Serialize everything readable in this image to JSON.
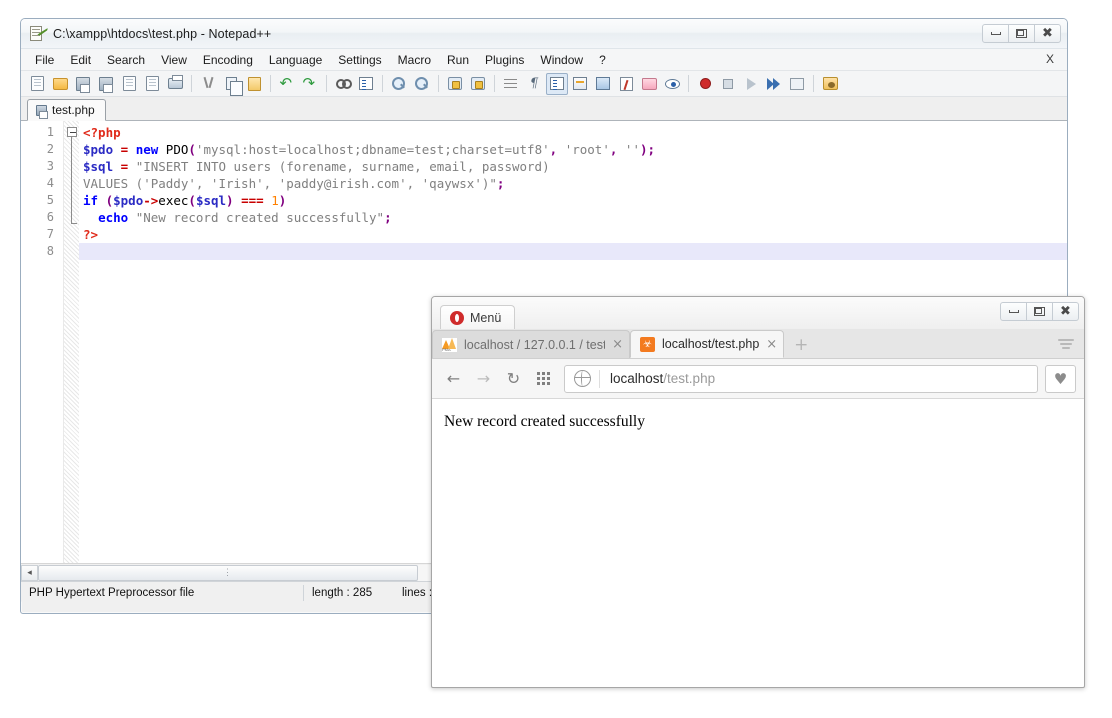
{
  "notepad": {
    "title": "C:\\xampp\\htdocs\\test.php - Notepad++",
    "icon": "notepad-plus-plus-icon",
    "window_buttons": {
      "minimize": "minimize-icon",
      "maximize": "maximize-icon",
      "close": "close-icon"
    },
    "menu": [
      "File",
      "Edit",
      "Search",
      "View",
      "Encoding",
      "Language",
      "Settings",
      "Macro",
      "Run",
      "Plugins",
      "Window",
      "?"
    ],
    "menu_close_doc": "X",
    "tab": {
      "label": "test.php"
    },
    "line_numbers": [
      "1",
      "2",
      "3",
      "4",
      "5",
      "6",
      "7",
      "8"
    ],
    "code_lines": [
      {
        "n": 1,
        "tokens": [
          {
            "t": "<?php",
            "c": "t-tag"
          }
        ]
      },
      {
        "n": 2,
        "tokens": [
          {
            "t": "$pdo",
            "c": "t-var"
          },
          {
            "t": " ",
            "c": "t-plain"
          },
          {
            "t": "=",
            "c": "t-op"
          },
          {
            "t": " ",
            "c": "t-plain"
          },
          {
            "t": "new",
            "c": "t-kw"
          },
          {
            "t": " PDO",
            "c": "t-plain"
          },
          {
            "t": "(",
            "c": "t-punc"
          },
          {
            "t": "'mysql:host=localhost;dbname=test;charset=utf8'",
            "c": "t-str"
          },
          {
            "t": ",",
            "c": "t-punc"
          },
          {
            "t": " ",
            "c": "t-plain"
          },
          {
            "t": "'root'",
            "c": "t-str"
          },
          {
            "t": ",",
            "c": "t-punc"
          },
          {
            "t": " ",
            "c": "t-plain"
          },
          {
            "t": "''",
            "c": "t-str"
          },
          {
            "t": ");",
            "c": "t-punc"
          }
        ]
      },
      {
        "n": 3,
        "tokens": [
          {
            "t": "$sql",
            "c": "t-var"
          },
          {
            "t": " ",
            "c": "t-plain"
          },
          {
            "t": "=",
            "c": "t-op"
          },
          {
            "t": " ",
            "c": "t-plain"
          },
          {
            "t": "\"INSERT INTO users (forename, surname, email, password)",
            "c": "t-str"
          }
        ]
      },
      {
        "n": 4,
        "tokens": [
          {
            "t": "VALUES ('Paddy', 'Irish', 'paddy@irish.com', 'qaywsx')\"",
            "c": "t-str"
          },
          {
            "t": ";",
            "c": "t-punc"
          }
        ]
      },
      {
        "n": 5,
        "tokens": [
          {
            "t": "if",
            "c": "t-kw"
          },
          {
            "t": " ",
            "c": "t-plain"
          },
          {
            "t": "(",
            "c": "t-punc"
          },
          {
            "t": "$pdo",
            "c": "t-var"
          },
          {
            "t": "->",
            "c": "t-op"
          },
          {
            "t": "exec",
            "c": "t-plain"
          },
          {
            "t": "(",
            "c": "t-punc"
          },
          {
            "t": "$sql",
            "c": "t-var"
          },
          {
            "t": ")",
            "c": "t-punc"
          },
          {
            "t": " ",
            "c": "t-plain"
          },
          {
            "t": "===",
            "c": "t-op"
          },
          {
            "t": " ",
            "c": "t-plain"
          },
          {
            "t": "1",
            "c": "t-num"
          },
          {
            "t": ")",
            "c": "t-punc"
          }
        ]
      },
      {
        "n": 6,
        "tokens": [
          {
            "t": "  ",
            "c": "t-plain"
          },
          {
            "t": "echo",
            "c": "t-kw"
          },
          {
            "t": " ",
            "c": "t-plain"
          },
          {
            "t": "\"New record created successfully\"",
            "c": "t-str"
          },
          {
            "t": ";",
            "c": "t-punc"
          }
        ]
      },
      {
        "n": 7,
        "tokens": [
          {
            "t": "?>",
            "c": "t-tag"
          }
        ]
      },
      {
        "n": 8,
        "tokens": [
          {
            "t": "",
            "c": "t-plain"
          }
        ]
      }
    ],
    "status": {
      "file_type": "PHP Hypertext Preprocessor file",
      "length": "length : 285",
      "lines": "lines :"
    },
    "hscroll": {
      "left_arrow": "◂",
      "thumb_grip": "⋮"
    }
  },
  "opera": {
    "menu_button": "Menü",
    "window_buttons": {
      "minimize": "minimize-icon",
      "maximize": "maximize-icon",
      "close": "close-icon"
    },
    "tabs": [
      {
        "label": "localhost / 127.0.0.1 / test",
        "favicon": "phpmyadmin-favicon",
        "active": false,
        "close": "×"
      },
      {
        "label": "localhost/test.php",
        "favicon": "xampp-favicon",
        "active": true,
        "close": "×"
      }
    ],
    "new_tab": "+",
    "nav": {
      "back": "←",
      "forward": "→",
      "reload": "↻",
      "speed_dial": "speed-dial-icon",
      "security_icon": "globe-icon",
      "url_host": "localhost",
      "url_path": "/test.php",
      "bookmark": "♥"
    },
    "page": {
      "body_text": "New record created successfully"
    }
  },
  "colors": {
    "php_tag": "#e02a1a",
    "variable": "#2b2bc4",
    "keyword": "#0000ff",
    "string": "#808080",
    "operator": "#c80000",
    "number": "#ff8000",
    "punctuation": "#800080",
    "current_line": "#e8e8fa",
    "opera_red": "#cf2b2b",
    "xampp_orange": "#f37a1f"
  }
}
